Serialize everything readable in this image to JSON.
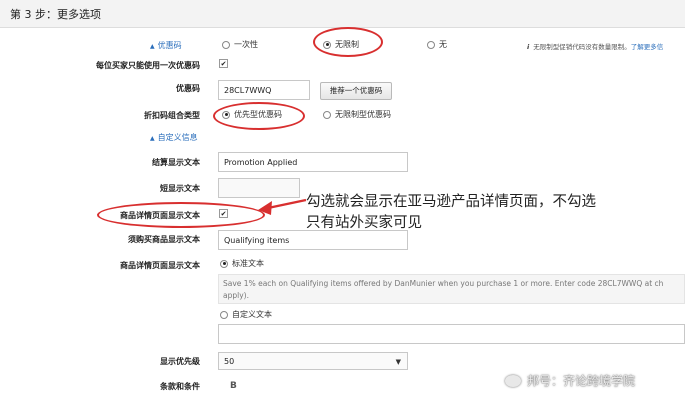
{
  "header": {
    "title": "第 3 步：更多选项"
  },
  "section_coupon": "优惠码",
  "coupon_type": {
    "options": [
      {
        "label": "一次性",
        "selected": false
      },
      {
        "label": "无限制",
        "selected": true
      },
      {
        "label": "无",
        "selected": false
      }
    ],
    "info_text": "无限制型促销代码没有数量限制。",
    "info_link": "了解更多信"
  },
  "once_per_buyer": {
    "label": "每位买家只能使用一次优惠码",
    "checked": true
  },
  "coupon_code": {
    "label": "优惠码",
    "value": "28CL7WWQ",
    "suggest_button": "推荐一个优惠码"
  },
  "combination": {
    "label": "折扣码组合类型",
    "options": [
      {
        "label": "优先型优惠码",
        "selected": true
      },
      {
        "label": "无限制型优惠码",
        "selected": false
      }
    ]
  },
  "section_custom": "自定义信息",
  "checkout_text": {
    "label": "结算显示文本",
    "value": "Promotion Applied"
  },
  "short_text": {
    "label": "短显示文本",
    "value": ""
  },
  "detail_page_display": {
    "label": "商品详情页面显示文本",
    "checked": true
  },
  "purchase_items_text": {
    "label": "须购买商品显示文本",
    "value": "Qualifying items"
  },
  "detail_page_text": {
    "label": "商品详情页面显示文本",
    "standard_option": "标准文本",
    "standard_text": "Save 1% each on Qualifying items offered by DanMunier when you purchase 1 or more. Enter code 28CL7WWQ at ch apply).",
    "custom_option": "自定义文本"
  },
  "priority": {
    "label": "显示优先级",
    "value": "50"
  },
  "terms": {
    "label": "条款和条件",
    "toolbar_glyph": "B"
  },
  "annotation": {
    "line1": "勾选就会显示在亚马逊产品详情页面，不勾选",
    "line2": "只有站外买家可见"
  },
  "watermark": "邦号：齐论跨境学院",
  "colors": {
    "annotation_red": "#d82f2f",
    "link_blue": "#2a6ebb"
  }
}
